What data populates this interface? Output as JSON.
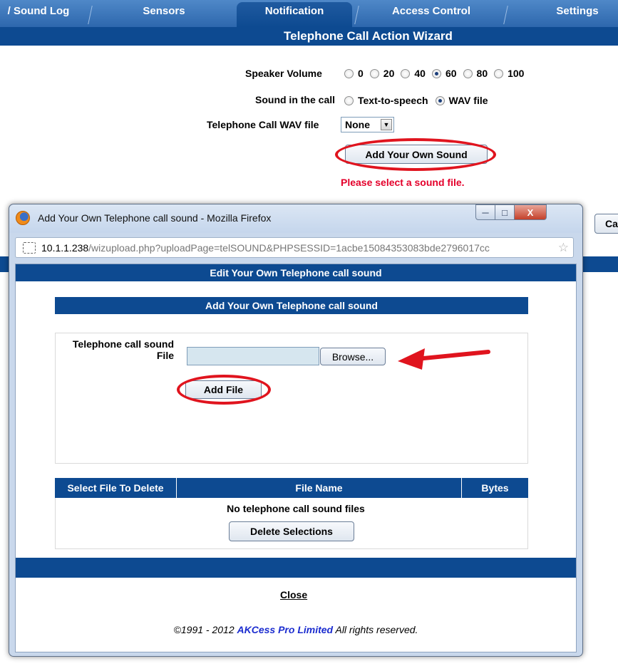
{
  "top_nav": {
    "tabs": [
      {
        "label": "/ Sound Log"
      },
      {
        "label": "Sensors"
      },
      {
        "label": "Notification"
      },
      {
        "label": "Access Control"
      },
      {
        "label": "Settings"
      }
    ],
    "active_tab": "Notification"
  },
  "wizard": {
    "title": "Telephone Call Action Wizard",
    "speaker_volume_label": "Speaker Volume",
    "volume_options": [
      "0",
      "20",
      "40",
      "60",
      "80",
      "100"
    ],
    "volume_selected": "60",
    "sound_in_call_label": "Sound in the call",
    "sound_options": [
      "Text-to-speech",
      "WAV file"
    ],
    "sound_selected": "WAV file",
    "wav_file_label": "Telephone Call WAV file",
    "wav_file_value": "None",
    "add_sound_button": "Add Your Own Sound",
    "error_message": "Please select a sound file.",
    "partial_button": "Ca"
  },
  "popup": {
    "window_title": "Add Your Own Telephone call sound - Mozilla Firefox",
    "url_host": "10.1.1.238",
    "url_path": "/wizupload.php?uploadPage=telSOUND&PHPSESSID=1acbe15084353083bde2796017cc",
    "header": "Edit Your Own Telephone call sound",
    "subheader": "Add Your Own Telephone call sound",
    "file_label_line1": "Telephone call sound",
    "file_label_line2": "File",
    "browse_button": "Browse...",
    "add_file_button": "Add File",
    "table_headers": [
      "Select File To Delete",
      "File Name",
      "Bytes"
    ],
    "empty_message": "No telephone call sound files",
    "delete_button": "Delete Selections",
    "close_link": "Close",
    "copyright_prefix": "©1991 - 2012 ",
    "copyright_brand": "AKCess Pro Limited",
    "copyright_suffix": " All rights reserved."
  },
  "colors": {
    "header_blue": "#0d4a91",
    "annotation_red": "#e0141e",
    "error_red": "#e4002b",
    "brand_blue": "#1b2ccf"
  }
}
